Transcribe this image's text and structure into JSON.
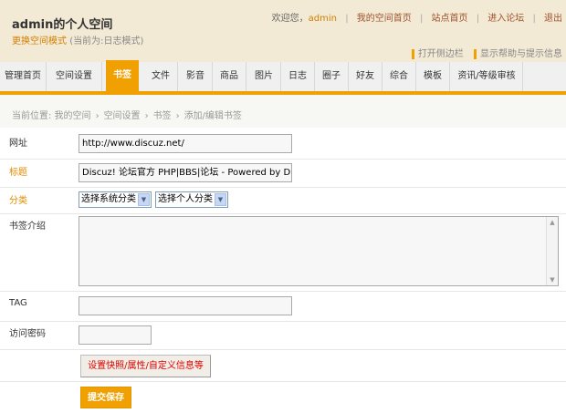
{
  "header": {
    "title": "admin的个人空间",
    "switch_link": "更换空间模式",
    "current_mode": "(当前为:日志模式)",
    "welcome": "欢迎您",
    "username": "admin",
    "links": [
      "我的空间首页",
      "站点首页",
      "进入论坛",
      "退出"
    ],
    "help_links": [
      "打开侧边栏",
      "显示帮助与提示信息"
    ]
  },
  "nav": {
    "items": [
      "管理首页",
      "空间设置",
      "书签",
      "文件",
      "影音",
      "商品",
      "图片",
      "日志",
      "圈子",
      "好友",
      "综合",
      "模板",
      "资讯/等级审核"
    ],
    "active": "书签"
  },
  "breadcrumb": [
    "当前位置: 我的空间",
    "空间设置",
    "书签",
    "添加/编辑书签"
  ],
  "form": {
    "url_label": "网址",
    "url_value": "http://www.discuz.net/",
    "title_label": "标题",
    "title_value": "Discuz! 论坛官方  PHP|BBS|论坛  - Powered by Discuz!",
    "category_label": "分类",
    "system_category": "选择系统分类",
    "personal_category": "选择个人分类",
    "intro_label": "书签介绍",
    "intro_value": "",
    "tag_label": "TAG",
    "tag_value": "",
    "password_label": "访问密码",
    "password_value": "",
    "settings_button": "设置快照/属性/自定义信息等",
    "submit_button": "提交保存"
  },
  "colors": {
    "accent": "#f0a000",
    "header_bg": "#f3ead6",
    "required_label": "#e68a00",
    "settings_text": "#e00000"
  }
}
